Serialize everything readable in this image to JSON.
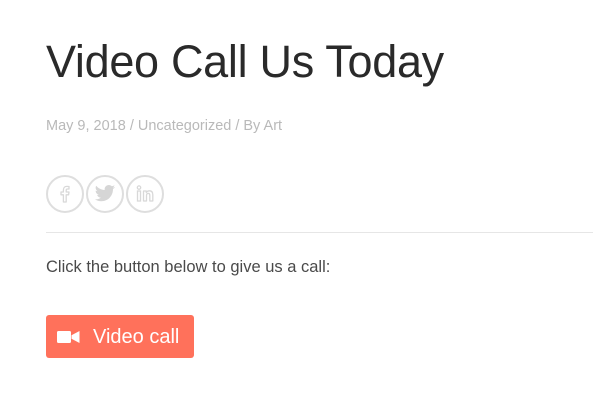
{
  "post": {
    "title": "Video Call Us Today",
    "meta": {
      "date": "May 9, 2018",
      "separator": "/",
      "category": "Uncategorized",
      "author_prefix": "By",
      "author": "Art"
    },
    "social": [
      {
        "name": "facebook",
        "icon": "facebook-icon"
      },
      {
        "name": "twitter",
        "icon": "twitter-icon"
      },
      {
        "name": "linkedin",
        "icon": "linkedin-icon"
      }
    ],
    "body_text": "Click the button below to give us a call:",
    "cta": {
      "label": "Video call",
      "icon": "video-camera-icon"
    }
  },
  "colors": {
    "title": "#2a2a2a",
    "meta": "#b9b9b9",
    "social_border": "#dedede",
    "body": "#4a4a4a",
    "button_bg": "#ff715b",
    "button_text": "#ffffff"
  }
}
